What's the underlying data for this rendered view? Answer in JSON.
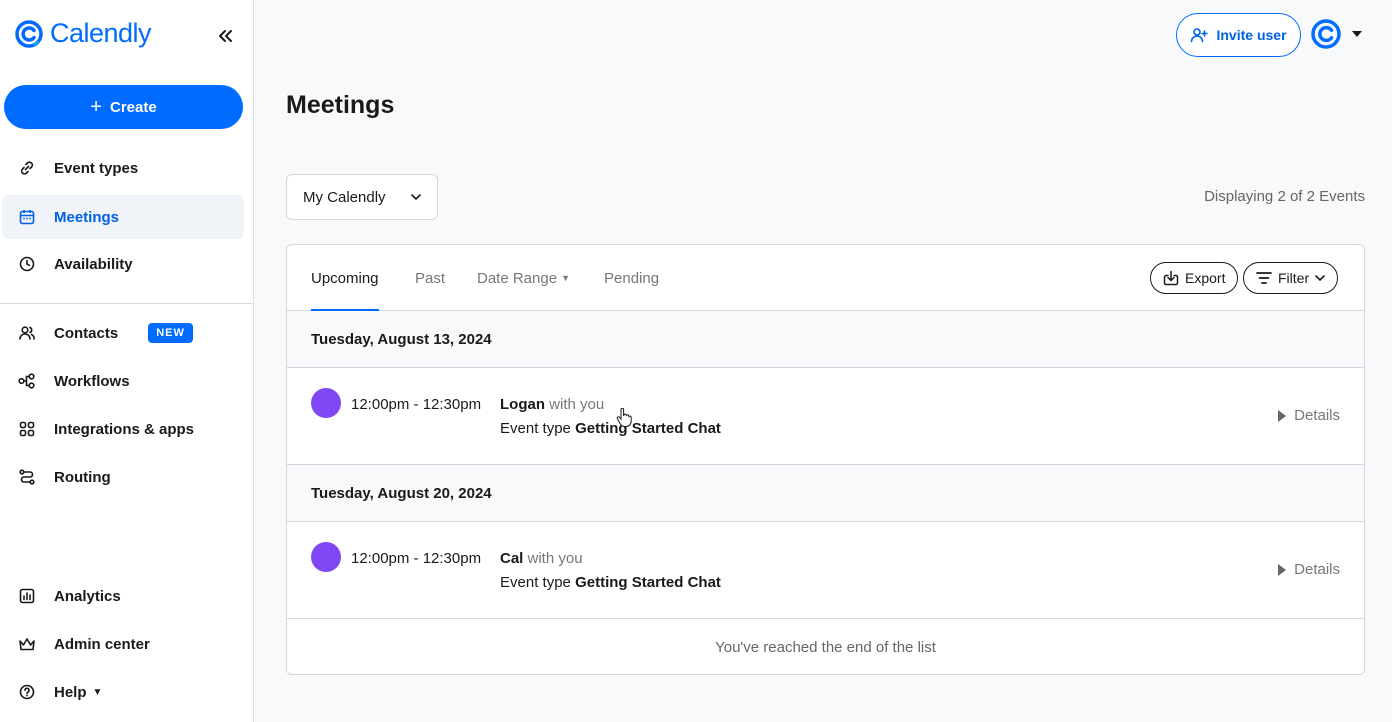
{
  "brand": {
    "name": "Calendly",
    "color": "#006bff"
  },
  "sidebar": {
    "create_label": "Create",
    "items": [
      {
        "label": "Event types",
        "icon": "link-icon"
      },
      {
        "label": "Meetings",
        "icon": "calendar-icon",
        "active": true
      },
      {
        "label": "Availability",
        "icon": "clock-icon"
      },
      {
        "label": "Contacts",
        "icon": "contacts-icon",
        "badge": "NEW"
      },
      {
        "label": "Workflows",
        "icon": "workflow-icon"
      },
      {
        "label": "Integrations & apps",
        "icon": "grid-icon"
      },
      {
        "label": "Routing",
        "icon": "routing-icon"
      },
      {
        "label": "Analytics",
        "icon": "chart-icon"
      },
      {
        "label": "Admin center",
        "icon": "crown-icon"
      },
      {
        "label": "Help",
        "icon": "help-icon"
      }
    ]
  },
  "topbar": {
    "invite_label": "Invite user"
  },
  "page": {
    "title": "Meetings",
    "calendar_select": "My Calendly",
    "displaying": "Displaying 2 of 2 Events"
  },
  "tabs": {
    "upcoming": "Upcoming",
    "past": "Past",
    "date_range": "Date Range",
    "pending": "Pending",
    "export": "Export",
    "filter": "Filter"
  },
  "events": [
    {
      "date": "Tuesday, August 13, 2024",
      "time": "12:00pm - 12:30pm",
      "name": "Logan",
      "with": "with you",
      "type_label": "Event type",
      "type": "Getting Started Chat",
      "details": "Details",
      "color": "#8247f5"
    },
    {
      "date": "Tuesday, August 20, 2024",
      "time": "12:00pm - 12:30pm",
      "name": "Cal",
      "with": "with you",
      "type_label": "Event type",
      "type": "Getting Started Chat",
      "details": "Details",
      "color": "#8247f5"
    }
  ],
  "end_note": "You've reached the end of the list"
}
